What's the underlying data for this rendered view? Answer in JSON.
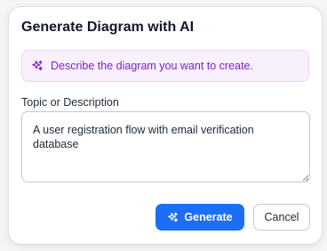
{
  "dialog": {
    "title": "Generate Diagram with AI",
    "banner": {
      "icon": "sparkles-icon",
      "text": "Describe the diagram you want to create.",
      "text_color": "#7e22ce",
      "background": "#f8f0fd"
    },
    "topic_field": {
      "label": "Topic or Description",
      "value": "A user registration flow with email verification database"
    },
    "buttons": {
      "generate": {
        "label": "Generate",
        "icon": "sparkles-icon",
        "color": "#1d6ef5"
      },
      "cancel": {
        "label": "Cancel"
      }
    }
  }
}
